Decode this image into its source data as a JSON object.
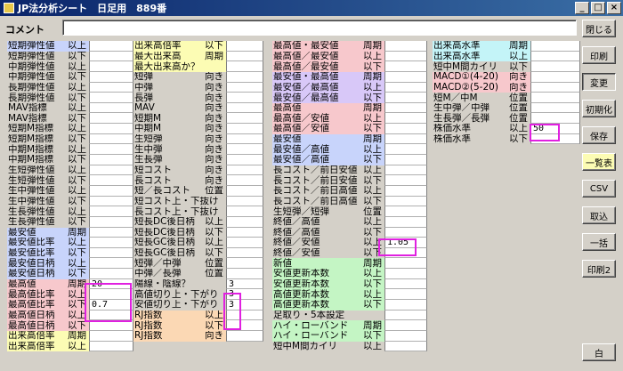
{
  "window": {
    "title": "JP法分析シート　日足用　889番"
  },
  "comment": {
    "label": "コメント",
    "value": ""
  },
  "columns": {
    "c1": [
      {
        "label": "短期弾性値",
        "suffix": "以上",
        "value": "",
        "bg": "bg-blue"
      },
      {
        "label": "短期弾性値",
        "suffix": "以下",
        "value": "",
        "bg": "bg-none"
      },
      {
        "label": "中期弾性値",
        "suffix": "以上",
        "value": "",
        "bg": "bg-none"
      },
      {
        "label": "中期弾性値",
        "suffix": "以下",
        "value": "",
        "bg": "bg-none"
      },
      {
        "label": "長期弾性値",
        "suffix": "以上",
        "value": "",
        "bg": "bg-none"
      },
      {
        "label": "長期弾性値",
        "suffix": "以下",
        "value": "",
        "bg": "bg-none"
      },
      {
        "label": "MAV指標",
        "suffix": "以上",
        "value": "",
        "bg": "bg-none"
      },
      {
        "label": "MAV指標",
        "suffix": "以下",
        "value": "",
        "bg": "bg-none"
      },
      {
        "label": "短期M指標",
        "suffix": "以上",
        "value": "",
        "bg": "bg-none"
      },
      {
        "label": "短期M指標",
        "suffix": "以下",
        "value": "",
        "bg": "bg-none"
      },
      {
        "label": "中期M指標",
        "suffix": "以上",
        "value": "",
        "bg": "bg-none"
      },
      {
        "label": "中期M指標",
        "suffix": "以下",
        "value": "",
        "bg": "bg-none"
      },
      {
        "label": "生短弾性値",
        "suffix": "以上",
        "value": "",
        "bg": "bg-none"
      },
      {
        "label": "生短弾性値",
        "suffix": "以下",
        "value": "",
        "bg": "bg-none"
      },
      {
        "label": "生中弾性値",
        "suffix": "以上",
        "value": "",
        "bg": "bg-none"
      },
      {
        "label": "生中弾性値",
        "suffix": "以下",
        "value": "",
        "bg": "bg-none"
      },
      {
        "label": "生長弾性値",
        "suffix": "以上",
        "value": "",
        "bg": "bg-none"
      },
      {
        "label": "生長弾性値",
        "suffix": "以下",
        "value": "",
        "bg": "bg-none"
      },
      {
        "label": "最安値",
        "suffix": "周期",
        "value": "",
        "bg": "bg-blue"
      },
      {
        "label": "最安値比率",
        "suffix": "以上",
        "value": "",
        "bg": "bg-blue"
      },
      {
        "label": "最安値比率",
        "suffix": "以下",
        "value": "",
        "bg": "bg-blue"
      },
      {
        "label": "最安値日柄",
        "suffix": "以上",
        "value": "",
        "bg": "bg-blue"
      },
      {
        "label": "最安値日柄",
        "suffix": "以下",
        "value": "",
        "bg": "bg-blue"
      },
      {
        "label": "最高値",
        "suffix": "周期",
        "value": "20",
        "bg": "bg-pink"
      },
      {
        "label": "最高値比率",
        "suffix": "以上",
        "value": "",
        "bg": "bg-pink"
      },
      {
        "label": "最高値比率",
        "suffix": "以下",
        "value": "0.7",
        "bg": "bg-pink"
      },
      {
        "label": "最高値日柄",
        "suffix": "以上",
        "value": "",
        "bg": "bg-pink"
      },
      {
        "label": "最高値日柄",
        "suffix": "以下",
        "value": "",
        "bg": "bg-pink"
      },
      {
        "label": "出来高倍率",
        "suffix": "周期",
        "value": "",
        "bg": "bg-yellow"
      },
      {
        "label": "出来高倍率",
        "suffix": "以上",
        "value": "",
        "bg": "bg-yellow"
      }
    ],
    "c2": [
      {
        "label": "出来高倍率",
        "suffix": "以下",
        "value": "",
        "bg": "bg-yellow"
      },
      {
        "label": "最大出来高",
        "suffix": "周期",
        "value": "",
        "bg": "bg-yellow"
      },
      {
        "label": "最大出来高か？",
        "suffix": "",
        "value": "",
        "bg": "bg-yellow"
      },
      {
        "label": "短弾",
        "suffix": "向き",
        "value": "",
        "bg": "bg-none"
      },
      {
        "label": "中弾",
        "suffix": "向き",
        "value": "",
        "bg": "bg-none"
      },
      {
        "label": "長弾",
        "suffix": "向き",
        "value": "",
        "bg": "bg-none"
      },
      {
        "label": "MAV",
        "suffix": "向き",
        "value": "",
        "bg": "bg-none"
      },
      {
        "label": "短期M",
        "suffix": "向き",
        "value": "",
        "bg": "bg-none"
      },
      {
        "label": "中期M",
        "suffix": "向き",
        "value": "",
        "bg": "bg-none"
      },
      {
        "label": "生短弾",
        "suffix": "向き",
        "value": "",
        "bg": "bg-none"
      },
      {
        "label": "生中弾",
        "suffix": "向き",
        "value": "",
        "bg": "bg-none"
      },
      {
        "label": "生長弾",
        "suffix": "向き",
        "value": "",
        "bg": "bg-none"
      },
      {
        "label": "短コスト",
        "suffix": "向き",
        "value": "",
        "bg": "bg-none"
      },
      {
        "label": "長コスト",
        "suffix": "向き",
        "value": "",
        "bg": "bg-none"
      },
      {
        "label": "短／長コスト",
        "suffix": "位置",
        "value": "",
        "bg": "bg-none"
      },
      {
        "label": "短コスト上・下抜け",
        "suffix": "",
        "value": "",
        "bg": "bg-none"
      },
      {
        "label": "長コスト上・下抜け",
        "suffix": "",
        "value": "",
        "bg": "bg-none"
      },
      {
        "label": "短長DC後日柄",
        "suffix": "以上",
        "value": "",
        "bg": "bg-none"
      },
      {
        "label": "短長DC後日柄",
        "suffix": "以下",
        "value": "",
        "bg": "bg-none"
      },
      {
        "label": "短長GC後日柄",
        "suffix": "以上",
        "value": "",
        "bg": "bg-none"
      },
      {
        "label": "短長GC後日柄",
        "suffix": "以下",
        "value": "",
        "bg": "bg-none"
      },
      {
        "label": "短弾／中弾",
        "suffix": "位置",
        "value": "",
        "bg": "bg-none"
      },
      {
        "label": "中弾／長弾",
        "suffix": "位置",
        "value": "",
        "bg": "bg-none"
      },
      {
        "label": "陽線・陰線？",
        "suffix": "",
        "value": "3",
        "bg": "bg-none"
      },
      {
        "label": "高値切り上・下がり",
        "suffix": "",
        "value": "3",
        "bg": "bg-none"
      },
      {
        "label": "安値切り上・下がり",
        "suffix": "",
        "value": "3",
        "bg": "bg-none"
      },
      {
        "label": "RJ指数",
        "suffix": "以上",
        "value": "",
        "bg": "bg-orange"
      },
      {
        "label": "RJ指数",
        "suffix": "以下",
        "value": "",
        "bg": "bg-orange"
      },
      {
        "label": "RJ指数",
        "suffix": "向き",
        "value": "",
        "bg": "bg-orange"
      }
    ],
    "c3": [
      {
        "label": "最高値・最安値",
        "suffix": "周期",
        "value": "",
        "bg": "bg-pink"
      },
      {
        "label": "最高値／最安値",
        "suffix": "以上",
        "value": "",
        "bg": "bg-pink"
      },
      {
        "label": "最高値／最安値",
        "suffix": "以下",
        "value": "",
        "bg": "bg-pink"
      },
      {
        "label": "最安値・最高値",
        "suffix": "周期",
        "value": "",
        "bg": "bg-purple"
      },
      {
        "label": "最安値／最高値",
        "suffix": "以上",
        "value": "",
        "bg": "bg-purple"
      },
      {
        "label": "最安値／最高値",
        "suffix": "以下",
        "value": "",
        "bg": "bg-purple"
      },
      {
        "label": "最高値",
        "suffix": "周期",
        "value": "",
        "bg": "bg-pink"
      },
      {
        "label": "最高値／安値",
        "suffix": "以上",
        "value": "",
        "bg": "bg-pink"
      },
      {
        "label": "最高値／安値",
        "suffix": "以下",
        "value": "",
        "bg": "bg-pink"
      },
      {
        "label": "最安値",
        "suffix": "周期",
        "value": "",
        "bg": "bg-blue"
      },
      {
        "label": "最安値／高値",
        "suffix": "以上",
        "value": "",
        "bg": "bg-blue"
      },
      {
        "label": "最安値／高値",
        "suffix": "以下",
        "value": "",
        "bg": "bg-blue"
      },
      {
        "label": "長コスト／前日安値",
        "suffix": "以上",
        "value": "",
        "bg": "bg-none"
      },
      {
        "label": "長コスト／前日安値",
        "suffix": "以下",
        "value": "",
        "bg": "bg-none"
      },
      {
        "label": "長コスト／前日高値",
        "suffix": "以上",
        "value": "",
        "bg": "bg-none"
      },
      {
        "label": "長コスト／前日高値",
        "suffix": "以下",
        "value": "",
        "bg": "bg-none"
      },
      {
        "label": "生短弾／短弾",
        "suffix": "位置",
        "value": "",
        "bg": "bg-none"
      },
      {
        "label": "終値／高値",
        "suffix": "以上",
        "value": "",
        "bg": "bg-none"
      },
      {
        "label": "終値／高値",
        "suffix": "以下",
        "value": "",
        "bg": "bg-none"
      },
      {
        "label": "終値／安値",
        "suffix": "以上",
        "value": "1.05",
        "bg": "bg-none"
      },
      {
        "label": "終値／安値",
        "suffix": "以下",
        "value": "",
        "bg": "bg-none"
      },
      {
        "label": "新値",
        "suffix": "周期",
        "value": "",
        "bg": "bg-green"
      },
      {
        "label": "安値更新本数",
        "suffix": "以上",
        "value": "",
        "bg": "bg-green"
      },
      {
        "label": "安値更新本数",
        "suffix": "以下",
        "value": "",
        "bg": "bg-green"
      },
      {
        "label": "高値更新本数",
        "suffix": "以上",
        "value": "",
        "bg": "bg-green"
      },
      {
        "label": "高値更新本数",
        "suffix": "以下",
        "value": "",
        "bg": "bg-green"
      },
      {
        "label": "足取り・5本設定",
        "suffix": "",
        "value": "",
        "bg": "bg-none"
      },
      {
        "label": "ハイ・ローバンド",
        "suffix": "周期",
        "value": "",
        "bg": "bg-green"
      },
      {
        "label": "ハイ・ローバンド",
        "suffix": "以下",
        "value": "",
        "bg": "bg-green"
      },
      {
        "label": "短中M間カイリ",
        "suffix": "以上",
        "value": "",
        "bg": "bg-none"
      }
    ],
    "c4": [
      {
        "label": "出来高水準",
        "suffix": "周期",
        "value": "",
        "bg": "bg-cyan"
      },
      {
        "label": "出来高水準",
        "suffix": "以上",
        "value": "",
        "bg": "bg-cyan"
      },
      {
        "label": "短中M間カイリ",
        "suffix": "以下",
        "value": "",
        "bg": "bg-none"
      },
      {
        "label": "MACD①(4-20)",
        "suffix": "向き",
        "value": "",
        "bg": "bg-pink"
      },
      {
        "label": "MACD②(5-20)",
        "suffix": "向き",
        "value": "",
        "bg": "bg-pink"
      },
      {
        "label": "短M／中M",
        "suffix": "位置",
        "value": "",
        "bg": "bg-none"
      },
      {
        "label": "生中弾／中弾",
        "suffix": "位置",
        "value": "",
        "bg": "bg-none"
      },
      {
        "label": "生長弾／長弾",
        "suffix": "位置",
        "value": "",
        "bg": "bg-none"
      },
      {
        "label": "株価水準",
        "suffix": "以上",
        "value": "50",
        "bg": "bg-none"
      },
      {
        "label": "株価水準",
        "suffix": "以下",
        "value": "",
        "bg": "bg-none"
      }
    ]
  },
  "buttons": [
    {
      "label": "閉じる",
      "name": "close-button",
      "style": ""
    },
    {
      "label": "印刷",
      "name": "print-button",
      "style": ""
    },
    {
      "label": "変更",
      "name": "change-button",
      "style": "pressed"
    },
    {
      "label": "初期化",
      "name": "initialize-button",
      "style": ""
    },
    {
      "label": "保存",
      "name": "save-button",
      "style": ""
    },
    {
      "label": "一覧表",
      "name": "list-button",
      "style": "active"
    },
    {
      "label": "CSV",
      "name": "csv-button",
      "style": ""
    },
    {
      "label": "取込",
      "name": "import-button",
      "style": ""
    },
    {
      "label": "一括",
      "name": "batch-button",
      "style": ""
    },
    {
      "label": "印刷2",
      "name": "print2-button",
      "style": ""
    },
    {
      "label": "白",
      "name": "white-button",
      "style": ""
    }
  ]
}
